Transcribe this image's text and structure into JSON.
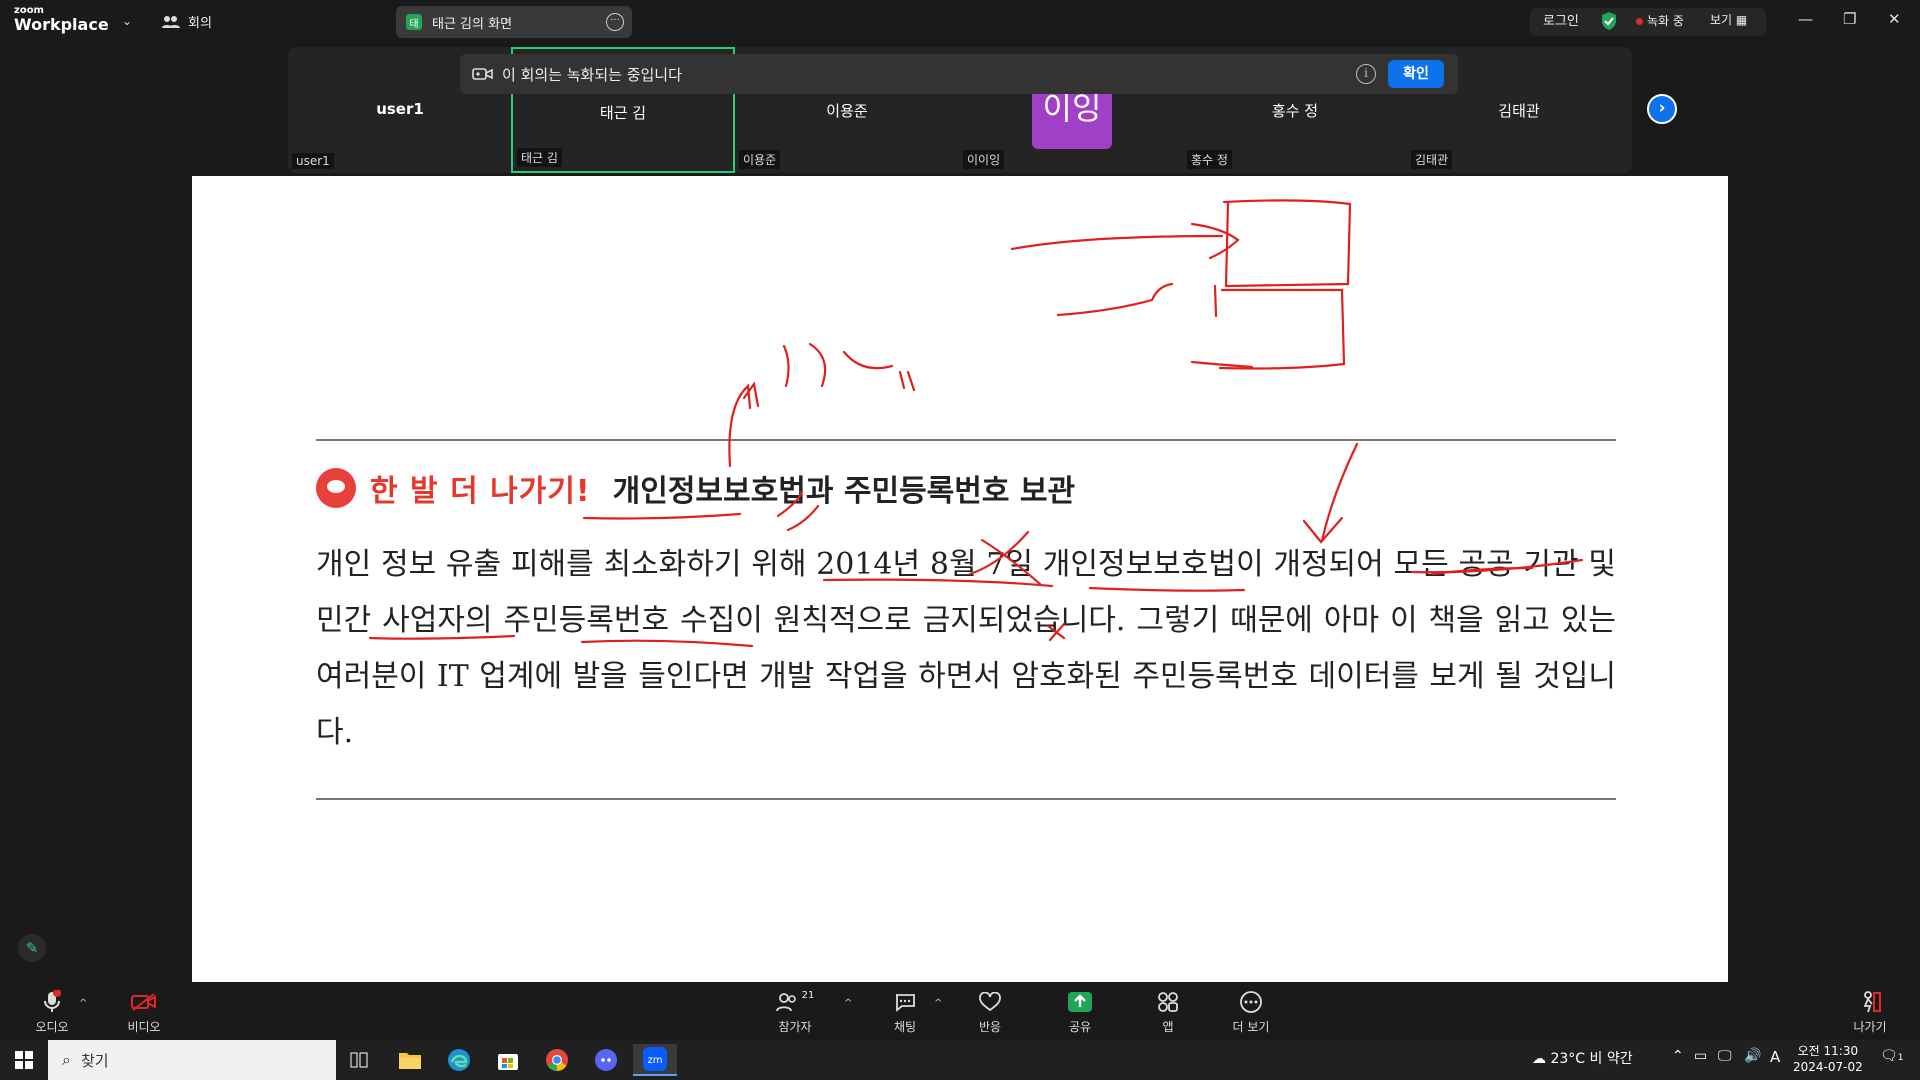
{
  "top": {
    "logo_small": "zoom",
    "logo_big": "Workplace",
    "meeting_label": "회의",
    "share_badge": "태",
    "share_title": "태근 김의 화면",
    "login": "로그인",
    "recording": "녹화 중",
    "view": "보기"
  },
  "participants": [
    {
      "name": "user1",
      "label": "user1"
    },
    {
      "name": "태근 김",
      "label": "태근 김"
    },
    {
      "name": "이용준",
      "label": "이용준"
    },
    {
      "name": "이잉",
      "label": "이이잉"
    },
    {
      "name": "홍수 정",
      "label": "홍수 정"
    },
    {
      "name": "김태관",
      "label": "김태관"
    }
  ],
  "avatar_text": "이잉",
  "record_notice": {
    "text": "이 회의는 녹화되는 중입니다",
    "confirm": "확인"
  },
  "document": {
    "heading_badge": "한 발 더 나가기!",
    "heading": "개인정보보호법과 주민등록번호 보관",
    "body": "개인 정보 유출 피해를 최소화하기 위해 2014년 8월 7일 개인정보보호법이 개정되어 모든 공공 기관 및 민간 사업자의 주민등록번호 수집이 원칙적으로 금지되었습니다. 그렇기 때문에 아마 이 책을 읽고 있는 여러분이 IT 업계에 발을 들인다면 개발 작업을 하면서 암호화된 주민등록번호 데이터를 보게 될 것입니다."
  },
  "toolbar": {
    "audio": "오디오",
    "video": "비디오",
    "participants": "참가자",
    "participants_count": "21",
    "chat": "채팅",
    "reactions": "반응",
    "share": "공유",
    "apps": "앱",
    "more": "더 보기",
    "leave": "나가기"
  },
  "taskbar": {
    "search": "찾기",
    "weather": "23°C  비 약간",
    "ime": "A",
    "time": "오전 11:30",
    "date": "2024-07-02",
    "notif_count": "1"
  },
  "colors": {
    "accent": "#0e72ed",
    "active": "#2ecc71",
    "ink": "#e02020",
    "avatar": "#a13fc6"
  }
}
